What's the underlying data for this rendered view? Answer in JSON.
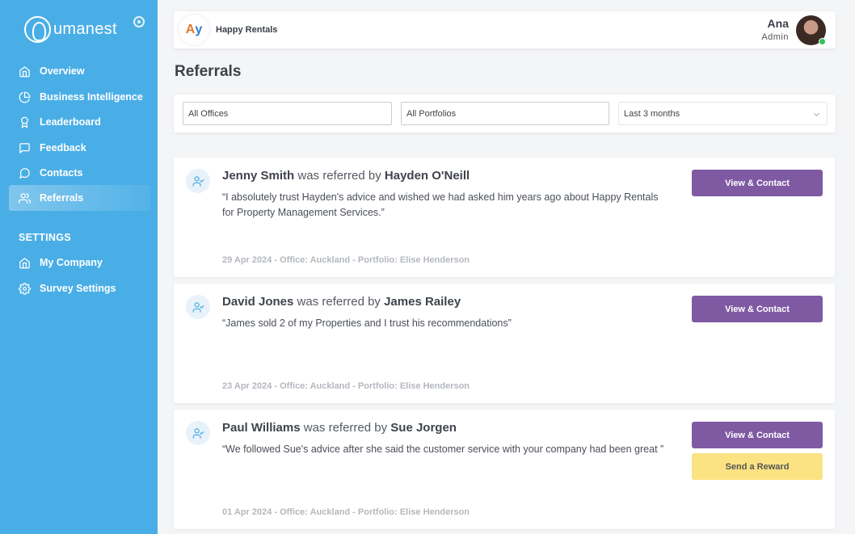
{
  "sidebar": {
    "logo_text": "umanest",
    "nav": [
      {
        "label": "Overview",
        "icon": "home-icon"
      },
      {
        "label": "Business Intelligence",
        "icon": "pie-chart-icon"
      },
      {
        "label": "Leaderboard",
        "icon": "award-icon"
      },
      {
        "label": "Feedback",
        "icon": "message-square-icon"
      },
      {
        "label": "Contacts",
        "icon": "message-circle-icon"
      },
      {
        "label": "Referrals",
        "icon": "users-icon",
        "active": true
      }
    ],
    "settings_heading": "SETTINGS",
    "settings": [
      {
        "label": "My Company",
        "icon": "home-icon"
      },
      {
        "label": "Survey Settings",
        "icon": "gear-icon"
      }
    ]
  },
  "header": {
    "company_name": "Happy Rentals",
    "user_name": "Ana",
    "user_role": "Admin"
  },
  "page_title": "Referrals",
  "filters": {
    "offices": "All Offices",
    "portfolios": "All Portfolios",
    "period": "Last 3 months"
  },
  "referrals": [
    {
      "name": "Jenny Smith",
      "referred_text": "was referred by",
      "referrer": "Hayden O'Neill",
      "quote": "“I absolutely trust Hayden's advice and wished we had asked him years ago about Happy Rentals for Property Management Services.”",
      "meta": "29 Apr 2024 - Office: Auckland - Portfolio: Elise Henderson",
      "contact_label": "View & Contact"
    },
    {
      "name": "David Jones",
      "referred_text": "was referred by",
      "referrer": "James Railey",
      "quote": "“James sold 2 of my Properties and I trust his recommendations”",
      "meta": "23 Apr 2024 - Office: Auckland - Portfolio: Elise Henderson",
      "contact_label": "View & Contact"
    },
    {
      "name": "Paul Williams",
      "referred_text": "was referred by",
      "referrer": "Sue Jorgen",
      "quote": "“We followed Sue's advice after she said the customer service with your company had been great ”",
      "meta": "01 Apr 2024 - Office: Auckland - Portfolio: Elise Henderson",
      "contact_label": "View & Contact",
      "reward_label": "Send a Reward"
    }
  ],
  "colors": {
    "sidebar": "#4aaee6",
    "primary_button": "#7f5aa3",
    "reward_button": "#fbe383",
    "online": "#30c25a"
  }
}
